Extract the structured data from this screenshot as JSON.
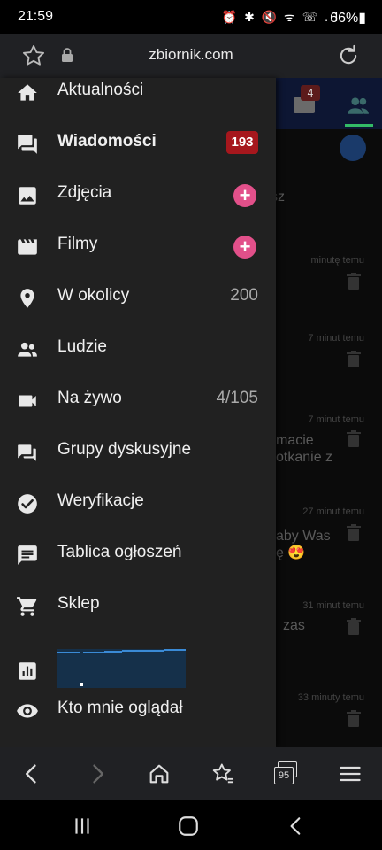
{
  "status_bar": {
    "time": "21:59",
    "icons": "⏰ ✱ 🔇 ᯤ ☏ .ıl",
    "battery": "66%▮"
  },
  "browser": {
    "url": "zbiornik.com"
  },
  "background_page": {
    "header_badge": "4",
    "snippets": [
      {
        "text": "sz",
        "time": ""
      },
      {
        "text": "",
        "time": "minutę temu"
      },
      {
        "text": "",
        "time": "7 minut temu"
      },
      {
        "text": "macie\notkanie z",
        "time": "7 minut temu"
      },
      {
        "text": "aby Was\nę 😍",
        "time": "27 minut temu"
      },
      {
        "text": "zas",
        "time": "31 minut temu"
      },
      {
        "text": "",
        "time": "33 minuty temu"
      }
    ]
  },
  "drawer": {
    "items": [
      {
        "label": "Aktualności",
        "icon": "home-icon"
      },
      {
        "label": "Wiadomości",
        "icon": "chat-icon",
        "badge": "193"
      },
      {
        "label": "Zdjęcia",
        "icon": "image-icon",
        "action": "+"
      },
      {
        "label": "Filmy",
        "icon": "film-icon",
        "action": "+"
      },
      {
        "label": "W okolicy",
        "icon": "location-pin-icon",
        "count": "200"
      },
      {
        "label": "Ludzie",
        "icon": "people-icon"
      },
      {
        "label": "Na żywo",
        "icon": "video-camera-icon",
        "count": "4/105"
      },
      {
        "label": "Grupy dyskusyjne",
        "icon": "forum-icon"
      },
      {
        "label": "Weryfikacje",
        "icon": "check-circle-icon"
      },
      {
        "label": "Tablica ogłoszeń",
        "icon": "announcement-icon"
      },
      {
        "label": "Sklep",
        "icon": "cart-icon"
      },
      {
        "label": "",
        "icon": "bar-chart-icon"
      },
      {
        "label": "Kto mnie oglądał",
        "icon": "eye-icon"
      }
    ]
  },
  "bottom_nav": {
    "tabs_count": "95",
    "items": [
      "back-icon",
      "forward-icon",
      "home-icon",
      "bookmarks-icon",
      "tabs-icon",
      "menu-icon"
    ]
  },
  "system_nav": {
    "items": [
      "recents-icon",
      "home-icon",
      "back-icon"
    ]
  },
  "colors": {
    "drawer_bg": "#212121",
    "badge_red": "#a6171d",
    "plus_pink": "#e2508a",
    "bar_blue": "#3a8ad6"
  }
}
